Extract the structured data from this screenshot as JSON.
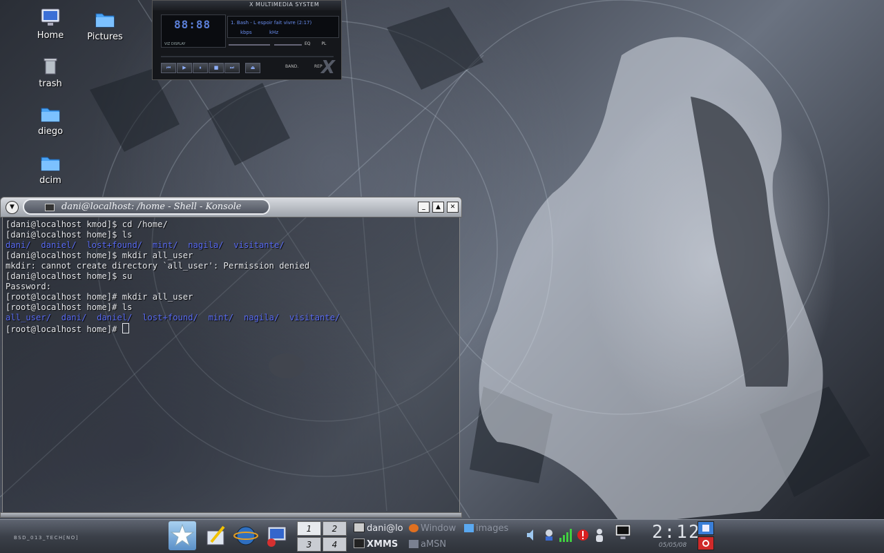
{
  "desktop": {
    "icons": [
      {
        "label": "Home",
        "icon": "monitor-icon"
      },
      {
        "label": "Pictures",
        "icon": "folder-icon"
      },
      {
        "label": "trash",
        "icon": "trash-icon"
      },
      {
        "label": "diego",
        "icon": "folder-icon"
      },
      {
        "label": "dcim",
        "icon": "folder-icon"
      }
    ]
  },
  "xmms": {
    "title": "X MULTIMEDIA SYSTEM",
    "time": "88:88",
    "vis_label": "VIZ DISPLAY",
    "song": "1. Bash - L espoir fait vivre (2:17)",
    "kbps": "kbps",
    "khz": "kHz",
    "eq_label": "EQ",
    "pl_label": "PL",
    "band_label": "BAND.",
    "rep_label": "REP",
    "logo": "X",
    "colors": {
      "display": "#5b7fd8",
      "background": "#15171b"
    }
  },
  "konsole": {
    "title": "dani@localhost: /home - Shell - Konsole",
    "menu_icon": "chevron-down-icon",
    "buttons": {
      "minimize": "_",
      "maximize": "▲",
      "close": "✕"
    },
    "lines": [
      "[dani@localhost kmod]$ cd /home/",
      "[dani@localhost home]$ ls",
      "",
      "[dani@localhost home]$ mkdir all_user",
      "mkdir: cannot create directory `all_user': Permission denied",
      "[dani@localhost home]$ su",
      "Password:",
      "[root@localhost home]# mkdir all_user",
      "[root@localhost home]# ls",
      "",
      "[root@localhost home]# "
    ],
    "ls1": [
      "dani/",
      "daniel/",
      "lost+found/",
      "mint/",
      "nagila/",
      "visitante/"
    ],
    "ls2": [
      "all_user/",
      "dani/",
      "daniel/",
      "lost+found/",
      "mint/",
      "nagila/",
      "visitante/"
    ],
    "colors": {
      "directory": "#5a6cf5",
      "text": "#e8eaee"
    }
  },
  "taskbar": {
    "brand": "BSD_013_TECH[NO]",
    "launchers": [
      "star-menu-icon",
      "editor-icon",
      "browser-icon",
      "display-icon"
    ],
    "pager": [
      "1",
      "2",
      "3",
      "4"
    ],
    "tasks": [
      {
        "label": "dani@lo",
        "dim": false,
        "icon": "terminal-icon"
      },
      {
        "label": "Window",
        "dim": true,
        "icon": "firefox-icon"
      },
      {
        "label": "images",
        "dim": true,
        "icon": "folder-icon"
      },
      {
        "label": "XMMS",
        "dim": false,
        "icon": "xmms-icon"
      },
      {
        "label": "aMSN",
        "dim": true,
        "icon": "amsn-icon"
      }
    ],
    "tray": [
      "speaker-icon",
      "network-icon",
      "signal-icon",
      "alert-icon",
      "user-icon",
      "monitor-icon"
    ],
    "clock": {
      "time": "2:12",
      "date": "05/05/08"
    }
  }
}
